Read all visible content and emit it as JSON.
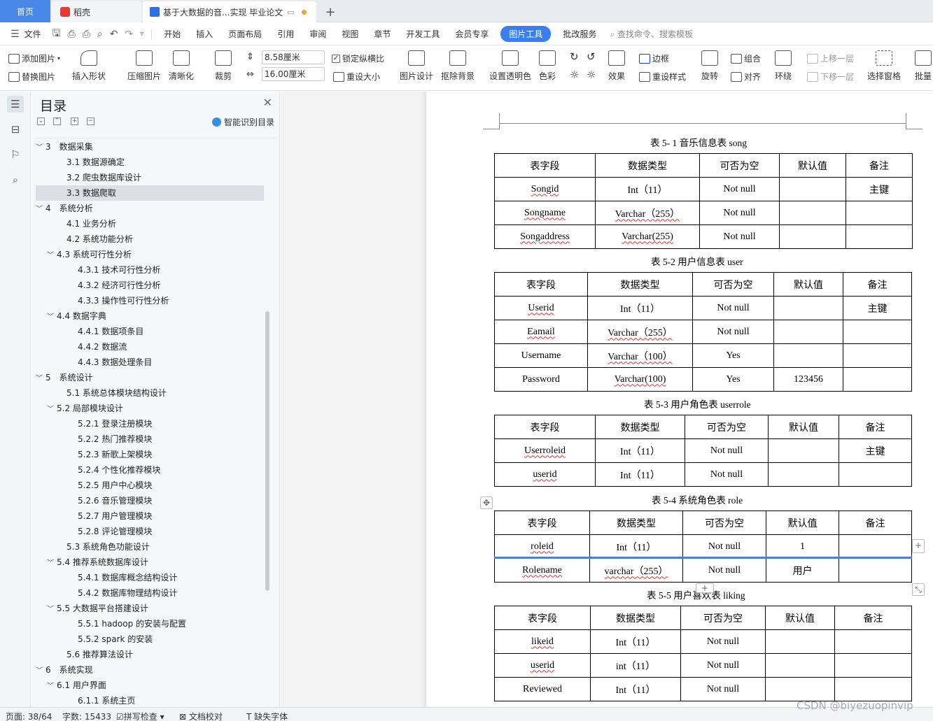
{
  "tabs": {
    "home": "首页",
    "daoke": "稻壳",
    "doc": "基于大数据的音...实现 毕业论文"
  },
  "menu": {
    "file": "文件",
    "items": [
      "开始",
      "插入",
      "页面布局",
      "引用",
      "审阅",
      "视图",
      "章节",
      "开发工具",
      "会员专享"
    ],
    "active": "图片工具",
    "after": "批改服务",
    "search": "查找命令、搜索模板"
  },
  "ribbon": {
    "add_image": "添加图片",
    "replace_image": "替换图片",
    "insert_shape": "插入形状",
    "compress": "压缩图片",
    "clarify": "清晰化",
    "crop": "裁剪",
    "width": "8.58厘米",
    "height": "16.00厘米",
    "lock_ratio": "锁定纵横比",
    "reset_size": "重设大小",
    "image_design": "图片设计",
    "remove_bg": "抠除背景",
    "set_transparent": "设置透明色",
    "color": "色彩",
    "effects": "效果",
    "border": "边框",
    "reset_style": "重设样式",
    "rotate": "旋转",
    "group": "组合",
    "align": "对齐",
    "wrap": "环绕",
    "bring_forward": "上移一层",
    "send_backward": "下移一层",
    "selection_pane": "选择窗格",
    "batch": "批量"
  },
  "toc": {
    "title": "目录",
    "smart": "智能识别目录",
    "items": [
      {
        "level": 1,
        "text": "3　数据采集",
        "chev": "﹀"
      },
      {
        "level": 2,
        "text": "3.1  数据源确定"
      },
      {
        "level": 2,
        "text": "3.2  爬虫数据库设计"
      },
      {
        "level": 2,
        "text": "3.3  数据爬取",
        "selected": true
      },
      {
        "level": 1,
        "text": "4　系统分析",
        "chev": "﹀"
      },
      {
        "level": 2,
        "text": "4.1  业务分析"
      },
      {
        "level": 2,
        "text": "4.2  系统功能分析"
      },
      {
        "level": 2,
        "text": "4.3  系统可行性分析",
        "chev": "﹀"
      },
      {
        "level": 3,
        "text": "4.3.1  技术可行性分析"
      },
      {
        "level": 3,
        "text": "4.3.2  经济可行性分析"
      },
      {
        "level": 3,
        "text": "4.3.3  操作性可行性分析"
      },
      {
        "level": 2,
        "text": "4.4  数据字典",
        "chev": "﹀"
      },
      {
        "level": 3,
        "text": "4.4.1  数据项条目"
      },
      {
        "level": 3,
        "text": "4.4.2  数据流"
      },
      {
        "level": 3,
        "text": "4.4.3  数据处理条目"
      },
      {
        "level": 1,
        "text": "5　系统设计",
        "chev": "﹀"
      },
      {
        "level": 2,
        "text": "5.1  系统总体模块结构设计"
      },
      {
        "level": 2,
        "text": "5.2  局部模块设计",
        "chev": "﹀"
      },
      {
        "level": 3,
        "text": "5.2.1  登录注册模块"
      },
      {
        "level": 3,
        "text": "5.2.2  热门推荐模块"
      },
      {
        "level": 3,
        "text": "5.2.3  新歌上架模块"
      },
      {
        "level": 3,
        "text": "5.2.4  个性化推荐模块"
      },
      {
        "level": 3,
        "text": "5.2.5  用户中心模块"
      },
      {
        "level": 3,
        "text": "5.2.6  音乐管理模块"
      },
      {
        "level": 3,
        "text": "5.2.7  用户管理模块"
      },
      {
        "level": 3,
        "text": "5.2.8  评论管理模块"
      },
      {
        "level": 2,
        "text": "5.3  系统角色功能设计"
      },
      {
        "level": 2,
        "text": "5.4  推荐系统数据库设计",
        "chev": "﹀"
      },
      {
        "level": 3,
        "text": "5.4.1  数据库概念结构设计"
      },
      {
        "level": 3,
        "text": "5.4.2  数据库物理结构设计"
      },
      {
        "level": 2,
        "text": "5.5  大数据平台搭建设计",
        "chev": "﹀"
      },
      {
        "level": 3,
        "text": "5.5.1 hadoop 的安装与配置"
      },
      {
        "level": 3,
        "text": "5.5.2 spark 的安装"
      },
      {
        "level": 2,
        "text": "5.6  推荐算法设计"
      },
      {
        "level": 1,
        "text": "6　系统实现",
        "chev": "﹀"
      },
      {
        "level": 2,
        "text": "6.1  用户界面",
        "chev": "﹀"
      },
      {
        "level": 3,
        "text": "6.1.1  系统主页"
      }
    ]
  },
  "tables": [
    {
      "title": "表 5- 1 音乐信息表 song",
      "rows": [
        [
          "表字段",
          "数据类型",
          "可否为空",
          "默认值",
          "备注"
        ],
        [
          "Songid",
          "Int（11）",
          "Not null",
          "",
          "主键"
        ],
        [
          "Songname",
          "Varchar（255）",
          "Not null",
          "",
          ""
        ],
        [
          "Songaddress",
          "Varchar(255)",
          "Not null",
          "",
          ""
        ]
      ]
    },
    {
      "title": "表 5-2  用户信息表 user",
      "rows": [
        [
          "表字段",
          "数据类型",
          "可否为空",
          "默认值",
          "备注"
        ],
        [
          "Userid",
          "Int（11）",
          "Not null",
          "",
          "主键"
        ],
        [
          "Eamail",
          "Varchar（255）",
          "Not null",
          "",
          ""
        ],
        [
          "Username",
          "Varchar（100）",
          "Yes",
          "",
          ""
        ],
        [
          "Password",
          "Varchar(100)",
          "Yes",
          "123456",
          ""
        ]
      ]
    },
    {
      "title": "表 5-3  用户角色表 userrole",
      "rows": [
        [
          "表字段",
          "数据类型",
          "可否为空",
          "默认值",
          "备注"
        ],
        [
          "Userroleid",
          "Int（11）",
          "Not null",
          "",
          "主键"
        ],
        [
          "userid",
          "Int（11）",
          "Not null",
          "",
          ""
        ]
      ]
    },
    {
      "title": "表 5-4  系统角色表 role",
      "rows": [
        [
          "表字段",
          "数据类型",
          "可否为空",
          "默认值",
          "备注"
        ],
        [
          "roleid",
          "Int（11）",
          "Not null",
          "1",
          ""
        ],
        [
          "Rolename",
          "varchar（255）",
          "Not null",
          "用户",
          ""
        ]
      ]
    },
    {
      "title": "表 5-5  用户喜欢表  liking",
      "rows": [
        [
          "表字段",
          "数据类型",
          "可否为空",
          "默认值",
          "备注"
        ],
        [
          "likeid",
          "Int（11）",
          "Not null",
          "",
          ""
        ],
        [
          "userid",
          "int（11）",
          "Not null",
          "",
          ""
        ],
        [
          "Reviewed",
          "Int（11）",
          "Not null",
          "",
          ""
        ]
      ]
    }
  ],
  "status": {
    "page": "页面: 38/64",
    "words": "字数: 15433",
    "spell": "拼写检查",
    "proof": "文档校对",
    "missing_font": "缺失字体"
  },
  "watermark": "CSDN @biyezuopinvip"
}
